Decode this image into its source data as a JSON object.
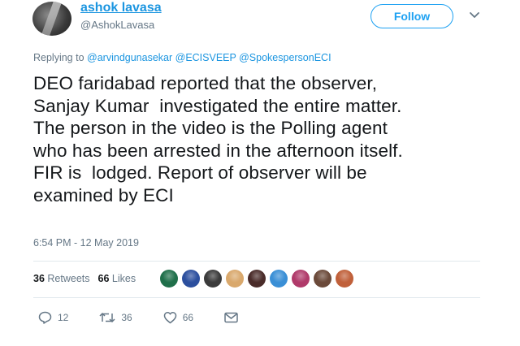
{
  "user": {
    "display_name": "ashok lavasa",
    "handle": "@AshokLavasa"
  },
  "follow_label": "Follow",
  "reply": {
    "prefix": "Replying to",
    "mentions": [
      "@arvindgunasekar",
      "@ECISVEEP",
      "@SpokespersonECI"
    ]
  },
  "tweet": {
    "text": "DEO faridabad reported that the observer,\nSanjay Kumar  investigated the entire matter.\nThe person in the video is the Polling agent\nwho has been arrested in the afternoon itself.\nFIR is  lodged. Report of observer will be\nexamined by ECI",
    "timestamp": "6:54 PM - 12 May 2019"
  },
  "stats": {
    "retweets_count": "36",
    "retweets_label": "Retweets",
    "likes_count": "66",
    "likes_label": "Likes"
  },
  "likers": [
    {
      "name": "liker-avatar-1",
      "color": "#1f6f4a"
    },
    {
      "name": "liker-avatar-2",
      "color": "#2c4f9e"
    },
    {
      "name": "liker-avatar-3",
      "color": "#3b3b3b"
    },
    {
      "name": "liker-avatar-4",
      "color": "#d9a86c"
    },
    {
      "name": "liker-avatar-5",
      "color": "#4a2c2a"
    },
    {
      "name": "liker-avatar-6",
      "color": "#3a8fd6"
    },
    {
      "name": "liker-avatar-7",
      "color": "#b03a6a"
    },
    {
      "name": "liker-avatar-8",
      "color": "#6b4a3a"
    },
    {
      "name": "liker-avatar-9",
      "color": "#c0603a"
    }
  ],
  "actions": {
    "reply_count": "12",
    "retweet_count": "36",
    "like_count": "66"
  },
  "colors": {
    "accent": "#1da1f2",
    "link": "#1b95e0",
    "muted": "#657786",
    "border": "#e1e8ed"
  }
}
